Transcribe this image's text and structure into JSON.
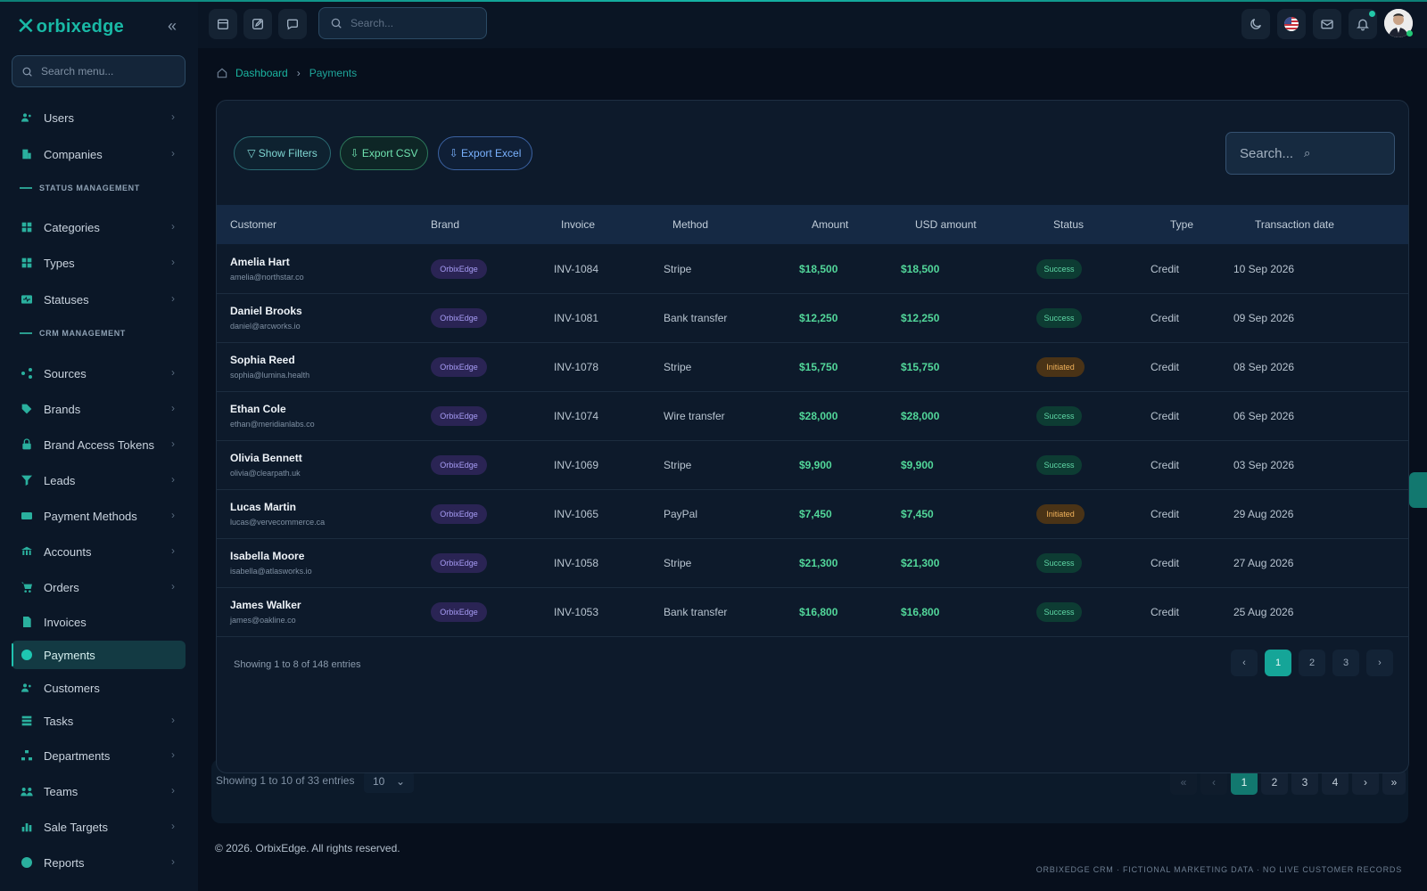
{
  "app": {
    "brand_name": "orbixedge",
    "accent_color": "#19b9a6"
  },
  "sidebar": {
    "search_placeholder": "Search menu...",
    "items": [
      {
        "label": "Users",
        "icon": "users-icon",
        "chevron": true
      },
      {
        "label": "Companies",
        "icon": "building-icon",
        "chevron": true
      },
      {
        "label": "Categories",
        "icon": "grid-icon",
        "chevron": true
      },
      {
        "label": "Types",
        "icon": "grid-icon",
        "chevron": true
      },
      {
        "label": "Statuses",
        "icon": "pulse-icon",
        "chevron": true
      },
      {
        "label": "Sources",
        "icon": "share-icon",
        "chevron": true
      },
      {
        "label": "Brands",
        "icon": "tag-icon",
        "chevron": true
      },
      {
        "label": "Brand Access Tokens",
        "icon": "lock-icon",
        "chevron": true
      },
      {
        "label": "Leads",
        "icon": "funnel-icon",
        "chevron": true
      },
      {
        "label": "Payment Methods",
        "icon": "credit-card-icon",
        "chevron": true
      },
      {
        "label": "Accounts",
        "icon": "bank-icon",
        "chevron": true
      },
      {
        "label": "Orders",
        "icon": "cart-icon",
        "chevron": true
      },
      {
        "label": "Invoices",
        "icon": "invoice-icon",
        "chevron": false
      },
      {
        "label": "Payments",
        "icon": "dollar-circle-icon",
        "chevron": false,
        "active": true
      },
      {
        "label": "Customers",
        "icon": "users-icon",
        "chevron": false
      },
      {
        "label": "Tasks",
        "icon": "list-icon",
        "chevron": true
      },
      {
        "label": "Departments",
        "icon": "org-chart-icon",
        "chevron": true
      },
      {
        "label": "Teams",
        "icon": "team-icon",
        "chevron": true
      },
      {
        "label": "Sale Targets",
        "icon": "bar-chart-icon",
        "chevron": true
      },
      {
        "label": "Reports",
        "icon": "pie-chart-icon",
        "chevron": true
      }
    ],
    "sections": {
      "status": "STATUS MANAGEMENT",
      "crm": "CRM MANAGEMENT"
    }
  },
  "topbar": {
    "search_placeholder": "Search...",
    "left_icons": [
      "calendar-icon",
      "edit-icon",
      "chat-icon"
    ],
    "right_icons": [
      "moon-icon",
      "us-flag-icon",
      "mail-icon",
      "bell-icon"
    ]
  },
  "breadcrumb": {
    "home": "Dashboard",
    "current": "Payments"
  },
  "toolbar": {
    "show_filters": "▽ Show Filters",
    "export_csv": "⇩ Export CSV",
    "export_excel": "⇩ Export Excel",
    "search_placeholder": "Search..."
  },
  "table": {
    "columns": [
      "Customer",
      "Brand",
      "Invoice",
      "Method",
      "Amount",
      "USD amount",
      "Status",
      "Type",
      "Transaction date"
    ],
    "rows": [
      {
        "name": "Amelia Hart",
        "email": "amelia@northstar.co",
        "brand": "OrbixEdge",
        "invoice": "INV-1084",
        "method": "Stripe",
        "amount": "$18,500",
        "usd": "$18,500",
        "status": "Success",
        "type": "Credit",
        "date": "10 Sep 2026"
      },
      {
        "name": "Daniel Brooks",
        "email": "daniel@arcworks.io",
        "brand": "OrbixEdge",
        "invoice": "INV-1081",
        "method": "Bank transfer",
        "amount": "$12,250",
        "usd": "$12,250",
        "status": "Success",
        "type": "Credit",
        "date": "09 Sep 2026"
      },
      {
        "name": "Sophia Reed",
        "email": "sophia@lumina.health",
        "brand": "OrbixEdge",
        "invoice": "INV-1078",
        "method": "Stripe",
        "amount": "$15,750",
        "usd": "$15,750",
        "status": "Initiated",
        "type": "Credit",
        "date": "08 Sep 2026"
      },
      {
        "name": "Ethan Cole",
        "email": "ethan@meridianlabs.co",
        "brand": "OrbixEdge",
        "invoice": "INV-1074",
        "method": "Wire transfer",
        "amount": "$28,000",
        "usd": "$28,000",
        "status": "Success",
        "type": "Credit",
        "date": "06 Sep 2026"
      },
      {
        "name": "Olivia Bennett",
        "email": "olivia@clearpath.uk",
        "brand": "OrbixEdge",
        "invoice": "INV-1069",
        "method": "Stripe",
        "amount": "$9,900",
        "usd": "$9,900",
        "status": "Success",
        "type": "Credit",
        "date": "03 Sep 2026"
      },
      {
        "name": "Lucas Martin",
        "email": "lucas@vervecommerce.ca",
        "brand": "OrbixEdge",
        "invoice": "INV-1065",
        "method": "PayPal",
        "amount": "$7,450",
        "usd": "$7,450",
        "status": "Initiated",
        "type": "Credit",
        "date": "29 Aug 2026"
      },
      {
        "name": "Isabella Moore",
        "email": "isabella@atlasworks.io",
        "brand": "OrbixEdge",
        "invoice": "INV-1058",
        "method": "Stripe",
        "amount": "$21,300",
        "usd": "$21,300",
        "status": "Success",
        "type": "Credit",
        "date": "27 Aug 2026"
      },
      {
        "name": "James Walker",
        "email": "james@oakline.co",
        "brand": "OrbixEdge",
        "invoice": "INV-1053",
        "method": "Bank transfer",
        "amount": "$16,800",
        "usd": "$16,800",
        "status": "Success",
        "type": "Credit",
        "date": "25 Aug 2026"
      }
    ]
  },
  "pagination": {
    "info": "Showing 1 to 8 of 148 entries",
    "prev": "‹",
    "next": "›",
    "pages": [
      "1",
      "2",
      "3"
    ],
    "active_page": "1"
  },
  "background_card": {
    "info": "Showing 1 to 10 of 33 entries",
    "page_size": "10",
    "pages": [
      "1",
      "2",
      "3",
      "4"
    ]
  },
  "footer": {
    "copyright": "© 2026. OrbixEdge. All rights reserved.",
    "note": "ORBIXEDGE CRM · FICTIONAL MARKETING DATA · NO LIVE CUSTOMER RECORDS"
  }
}
